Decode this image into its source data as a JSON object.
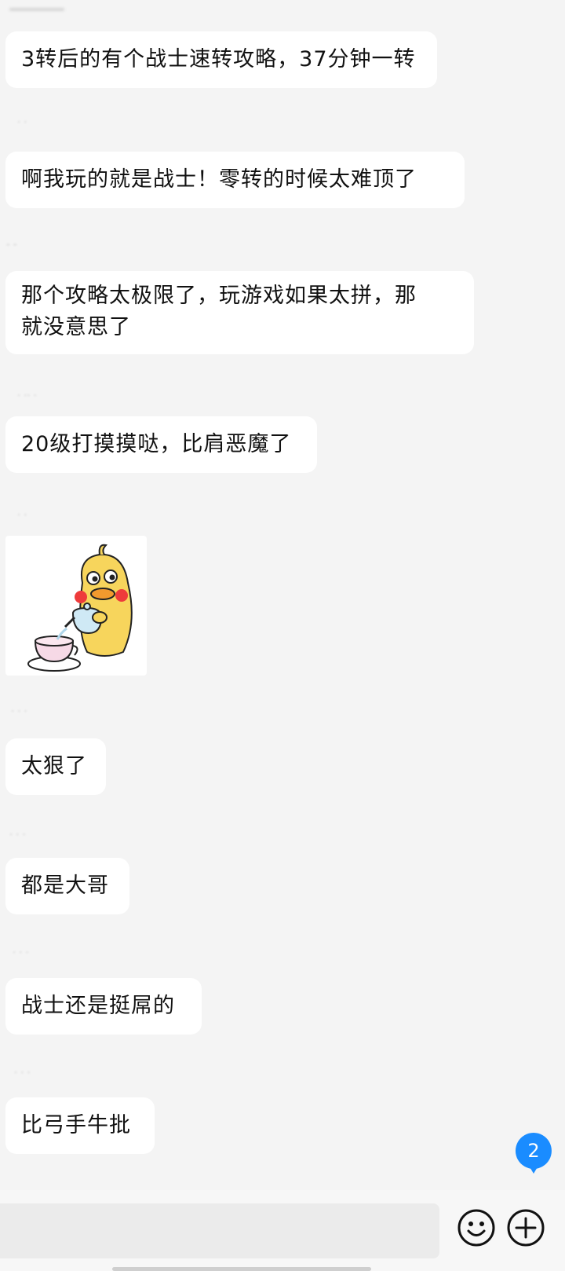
{
  "badge": {
    "count": "2"
  },
  "colors": {
    "background": "#f4f4f4",
    "bubble": "#ffffff",
    "badge": "#1a8cff",
    "text": "#111111"
  },
  "messages": [
    {
      "text": "3转后的有个战士速转攻略，37分钟一转"
    },
    {
      "text": "啊我玩的就是战士！零转的时候太难顶了"
    },
    {
      "lines": [
        "那个攻略太极限了，玩游戏如果太拼，那",
        "就没意思了"
      ]
    },
    {
      "text": "20级打摸摸哒，比肩恶魔了"
    },
    {
      "sticker": "duck-pouring-tea"
    },
    {
      "text": "太狠了"
    },
    {
      "text": "都是大哥"
    },
    {
      "text": "战士还是挺屌的"
    },
    {
      "text": "比弓手牛批"
    }
  ],
  "senders_blurred": [
    "- -",
    "· ·",
    "· ·· ·",
    "· ·",
    "· · ·",
    "· · ·",
    "· · ·",
    "· · ·",
    "· ·"
  ],
  "icons": {
    "emoji": "smiley-icon",
    "add": "plus-circle-icon"
  }
}
